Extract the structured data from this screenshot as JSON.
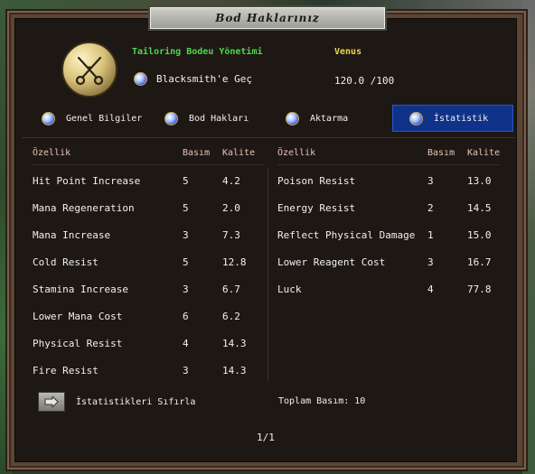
{
  "window": {
    "title": "Bod Haklarınız"
  },
  "header": {
    "task_name": "Tailoring Bodeu Yönetimi",
    "player_name": "Venus",
    "action_label": "Blacksmith'e Geç",
    "points": "120.0 /100"
  },
  "tabs": [
    {
      "label": "Genel Bilgiler"
    },
    {
      "label": "Bod Hakları"
    },
    {
      "label": "Aktarma"
    },
    {
      "label": "İstatistik",
      "active": true
    }
  ],
  "columns": {
    "property": "Özellik",
    "count": "Basım",
    "quality": "Kalite"
  },
  "stats_left": [
    {
      "name": "Hit Point Increase",
      "count": "5",
      "quality": "4.2"
    },
    {
      "name": "Mana Regeneration",
      "count": "5",
      "quality": "2.0"
    },
    {
      "name": "Mana Increase",
      "count": "3",
      "quality": "7.3"
    },
    {
      "name": "Cold Resist",
      "count": "5",
      "quality": "12.8"
    },
    {
      "name": "Stamina Increase",
      "count": "3",
      "quality": "6.7"
    },
    {
      "name": "Lower Mana Cost",
      "count": "6",
      "quality": "6.2"
    },
    {
      "name": "Physical Resist",
      "count": "4",
      "quality": "14.3"
    },
    {
      "name": "Fire Resist",
      "count": "3",
      "quality": "14.3"
    }
  ],
  "stats_right": [
    {
      "name": "Poison Resist",
      "count": "3",
      "quality": "13.0"
    },
    {
      "name": "Energy Resist",
      "count": "2",
      "quality": "14.5"
    },
    {
      "name": "Reflect Physical Damage",
      "count": "1",
      "quality": "15.0"
    },
    {
      "name": "Lower Reagent Cost",
      "count": "3",
      "quality": "16.7"
    },
    {
      "name": "Luck",
      "count": "4",
      "quality": "77.8"
    }
  ],
  "footer": {
    "reset_label": "İstatistikleri Sıfırla",
    "total_label": "Toplam Basım: 10",
    "page": "1/1"
  },
  "colors": {
    "task": "#4cd84c",
    "player": "#e8d84a",
    "active_tab": "#10338a",
    "header_text": "#e6c4b4"
  }
}
